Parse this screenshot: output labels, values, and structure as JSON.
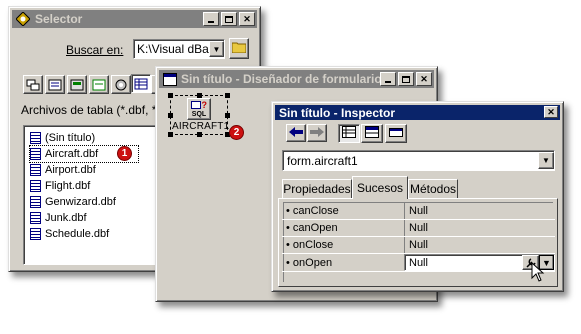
{
  "selector": {
    "title": "Selector",
    "search_label": "Buscar en:",
    "search_value": "K:\\Visual dBas",
    "filter_text": "Archivos de tabla (*.dbf, *.d",
    "files": [
      "(Sin título)",
      "Aircraft.dbf",
      "Airport.dbf",
      "Flight.dbf",
      "Genwizard.dbf",
      "Junk.dbf",
      "Schedule.dbf"
    ],
    "selected_index": 1
  },
  "designer": {
    "title": "Sin título - Diseñador de formularios",
    "component_label": "AIRCRAFT1",
    "component_icon_text": "SQL"
  },
  "inspector": {
    "title": "Sin título - Inspector",
    "object_value": "form.aircraft1",
    "tabs": [
      "Propiedades",
      "Sucesos",
      "Métodos"
    ],
    "active_tab": 1,
    "events": [
      {
        "name": "canClose",
        "value": "Null"
      },
      {
        "name": "canOpen",
        "value": "Null"
      },
      {
        "name": "onClose",
        "value": "Null"
      },
      {
        "name": "onOpen",
        "value": "Null"
      }
    ],
    "selected_event": 3
  },
  "callouts": [
    "1",
    "2"
  ],
  "colors": {
    "active_title": "#0a246a",
    "inactive_title": "#808080",
    "face": "#d4d0c8",
    "callout": "#cc1111"
  }
}
